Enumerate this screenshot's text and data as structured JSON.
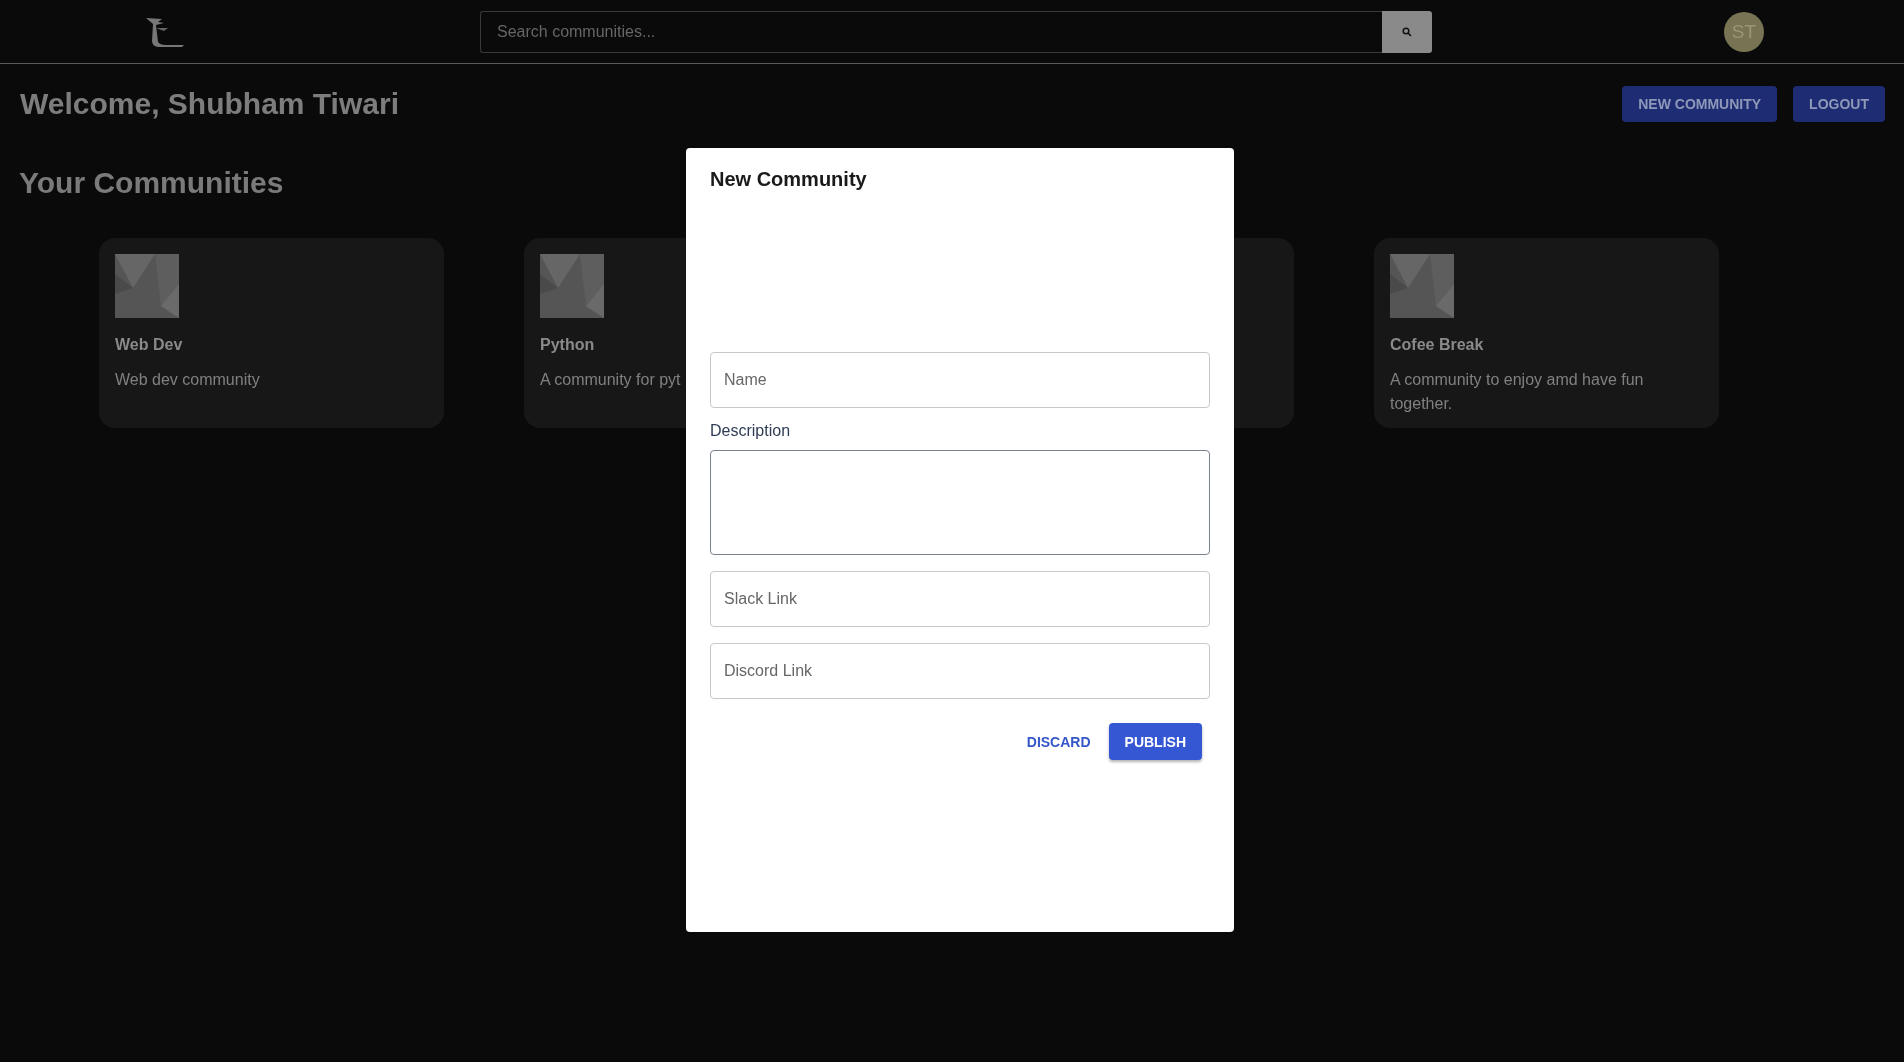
{
  "header": {
    "search": {
      "placeholder": "Search communities..."
    },
    "avatar": {
      "initials": "ST"
    }
  },
  "welcome": "Welcome, Shubham Tiwari",
  "actions": [
    {
      "label": "NEW COMMUNITY"
    },
    {
      "label": "LOGOUT"
    }
  ],
  "section_title": "Your Communities",
  "cards": [
    {
      "kind": "community",
      "title": "Web Dev",
      "description": "Web dev community"
    },
    {
      "kind": "community",
      "title": "Python",
      "description": "A community for pyt"
    },
    {
      "kind": "covered"
    },
    {
      "kind": "community",
      "title": "Cofee Break",
      "description": "A community to enjoy amd have fun together."
    }
  ],
  "dialog": {
    "title": "New Community",
    "fields": [
      {
        "kind": "input",
        "placeholder": "Name"
      },
      {
        "kind": "textarea",
        "label": "Description"
      },
      {
        "kind": "input",
        "placeholder": "Slack Link"
      },
      {
        "kind": "input",
        "placeholder": "Discord Link"
      }
    ],
    "buttons": [
      {
        "kind": "text",
        "label": "DISCARD"
      },
      {
        "kind": "contained",
        "label": "PUBLISH"
      }
    ]
  }
}
